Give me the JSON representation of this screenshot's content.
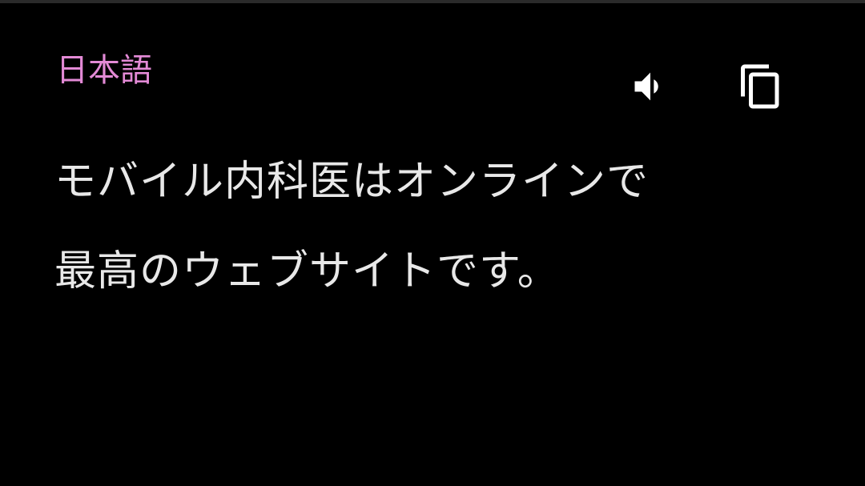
{
  "card": {
    "language": "日本語",
    "translation_lines": [
      "モバイル内科医はオンラインで",
      "最高のウェブサイトです。"
    ],
    "actions": {
      "speak_icon": "speaker-icon",
      "copy_icon": "copy-icon"
    }
  },
  "colors": {
    "background": "#000000",
    "language_label": "#e38ad6",
    "text": "#e8e8e8",
    "icon": "#ffffff"
  }
}
